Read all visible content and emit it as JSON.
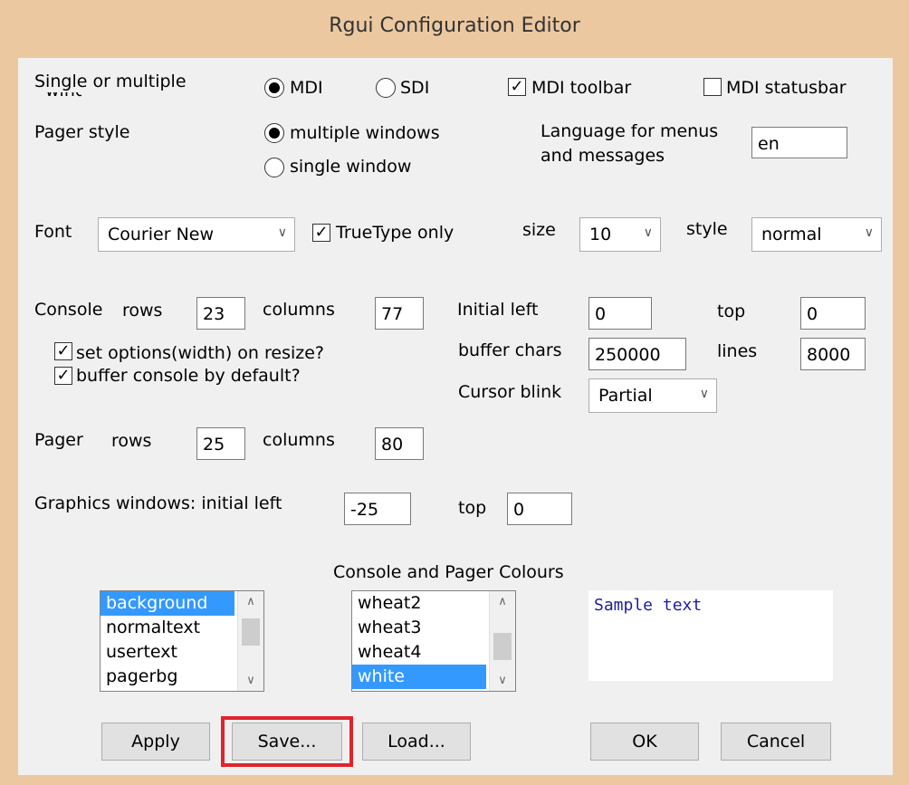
{
  "window": {
    "title": "Rgui Configuration Editor"
  },
  "interface": {
    "label": "Single or multiple",
    "label_line2": "windows",
    "mdi_label": "MDI",
    "sdi_label": "SDI",
    "selected": "MDI",
    "mdi_toolbar_label": "MDI toolbar",
    "mdi_toolbar_checked": true,
    "mdi_statusbar_label": "MDI statusbar",
    "mdi_statusbar_checked": false
  },
  "pager_style": {
    "label": "Pager style",
    "multiple_label": "multiple windows",
    "single_label": "single window",
    "selected": "multiple windows"
  },
  "language": {
    "label_line1": "Language for menus",
    "label_line2": "and messages",
    "value": "en"
  },
  "font": {
    "label": "Font",
    "value": "Courier New",
    "truetype_label": "TrueType only",
    "truetype_checked": true,
    "size_label": "size",
    "size_value": "10",
    "style_label": "style",
    "style_value": "normal"
  },
  "console": {
    "label": "Console",
    "rows_label": "rows",
    "rows_value": "23",
    "columns_label": "columns",
    "columns_value": "77",
    "set_options_label": "set options(width) on resize?",
    "set_options_checked": true,
    "buffer_default_label": "buffer console by default?",
    "buffer_default_checked": true
  },
  "position": {
    "initial_left_label": "Initial left",
    "initial_left_value": "0",
    "top_label": "top",
    "top_value": "0",
    "buffer_chars_label": "buffer chars",
    "buffer_chars_value": "250000",
    "lines_label": "lines",
    "lines_value": "8000",
    "cursor_blink_label": "Cursor blink",
    "cursor_blink_value": "Partial"
  },
  "pager": {
    "label": "Pager",
    "rows_label": "rows",
    "rows_value": "25",
    "columns_label": "columns",
    "columns_value": "80"
  },
  "graphics": {
    "label": "Graphics windows: initial left",
    "left_value": "-25",
    "top_label": "top",
    "top_value": "0"
  },
  "colours": {
    "title": "Console and Pager Colours",
    "elements": [
      "background",
      "normaltext",
      "usertext",
      "pagerbg"
    ],
    "elements_selected": "background",
    "colour_names": [
      "wheat2",
      "wheat3",
      "wheat4",
      "white"
    ],
    "colour_selected": "white",
    "sample_text": "Sample text",
    "sample_text_color": "#1e1e9e",
    "selection_color": "#3399ff"
  },
  "buttons": {
    "apply": "Apply",
    "save": "Save...",
    "load": "Load...",
    "ok": "OK",
    "cancel": "Cancel"
  },
  "colors": {
    "frame": "#ecc8a0",
    "dialog_bg": "#f0f0f0",
    "highlight": "#e0242c"
  }
}
